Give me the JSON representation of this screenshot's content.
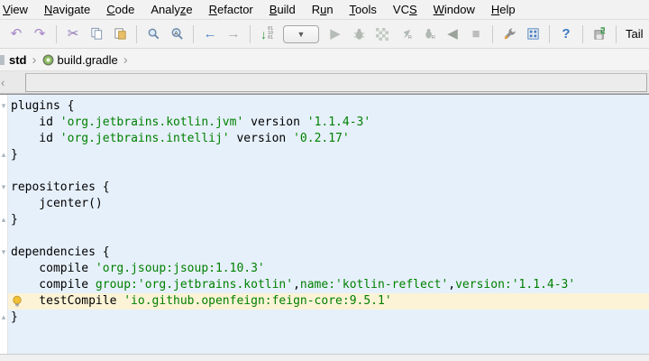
{
  "menu": {
    "items": [
      {
        "label": "View",
        "u": 0
      },
      {
        "label": "Navigate",
        "u": 0
      },
      {
        "label": "Code",
        "u": 0
      },
      {
        "label": "Analyze",
        "u": 5
      },
      {
        "label": "Refactor",
        "u": 0
      },
      {
        "label": "Build",
        "u": 0
      },
      {
        "label": "Run",
        "u": 1
      },
      {
        "label": "Tools",
        "u": 0
      },
      {
        "label": "VCS",
        "u": 2
      },
      {
        "label": "Window",
        "u": 0
      },
      {
        "label": "Help",
        "u": 0
      }
    ]
  },
  "toolbar": {
    "items": [
      {
        "name": "undo",
        "kind": "glyph",
        "glyph": "↶",
        "color": "#a583c6"
      },
      {
        "name": "redo",
        "kind": "glyph",
        "glyph": "↷",
        "color": "#a583c6"
      },
      {
        "kind": "sep"
      },
      {
        "name": "cut",
        "kind": "glyph",
        "glyph": "✂",
        "color": "#8d76b5"
      },
      {
        "name": "copy",
        "kind": "copy"
      },
      {
        "name": "paste",
        "kind": "paste"
      },
      {
        "kind": "sep"
      },
      {
        "name": "find",
        "kind": "magnifier"
      },
      {
        "name": "replace",
        "kind": "magnifier-a"
      },
      {
        "kind": "sep"
      },
      {
        "name": "back",
        "kind": "glyph",
        "glyph": "←",
        "color": "#4c86c8"
      },
      {
        "name": "forward",
        "kind": "glyph",
        "glyph": "→",
        "color": "#aaaaaa"
      },
      {
        "kind": "sep"
      },
      {
        "name": "update-project",
        "kind": "digits",
        "bits": [
          "01",
          "10",
          "01"
        ]
      },
      {
        "name": "run-configurations",
        "kind": "combo",
        "glyph": "▼"
      },
      {
        "name": "run",
        "kind": "glyph",
        "glyph": "▶",
        "color": "#b6bcb6"
      },
      {
        "name": "debug",
        "kind": "bug"
      },
      {
        "name": "run-with-coverage",
        "kind": "checker"
      },
      {
        "name": "profile",
        "kind": "rocketR"
      },
      {
        "name": "attach-profiler",
        "kind": "bugR"
      },
      {
        "name": "rerun",
        "kind": "glyph",
        "glyph": "◀",
        "color": "#9aa39a"
      },
      {
        "name": "stop",
        "kind": "glyph",
        "glyph": "■",
        "color": "#bcbcbc"
      },
      {
        "kind": "sep"
      },
      {
        "name": "settings",
        "kind": "wrench"
      },
      {
        "name": "project-structure",
        "kind": "grid"
      },
      {
        "kind": "sep"
      },
      {
        "name": "help",
        "kind": "glyph",
        "glyph": "?",
        "color": "#3b78c2",
        "bold": true
      },
      {
        "kind": "sep"
      },
      {
        "name": "save-tail",
        "kind": "disk"
      },
      {
        "kind": "sep"
      },
      {
        "name": "tail",
        "kind": "label",
        "label": "Tail"
      }
    ]
  },
  "breadcrumbs": {
    "items": [
      "std",
      "build.gradle"
    ]
  },
  "editor": {
    "file_language": "gradle",
    "lines": [
      {
        "fold": "start",
        "segments": [
          {
            "t": "plugins {",
            "c": "p"
          }
        ]
      },
      {
        "segments": [
          {
            "t": "    id ",
            "c": "p"
          },
          {
            "t": "'org.jetbrains.kotlin.jvm'",
            "c": "s"
          },
          {
            "t": " version ",
            "c": "p"
          },
          {
            "t": "'1.1.4-3'",
            "c": "s"
          }
        ]
      },
      {
        "segments": [
          {
            "t": "    id ",
            "c": "p"
          },
          {
            "t": "'org.jetbrains.intellij'",
            "c": "s"
          },
          {
            "t": " version ",
            "c": "p"
          },
          {
            "t": "'0.2.17'",
            "c": "s"
          }
        ]
      },
      {
        "fold": "end",
        "segments": [
          {
            "t": "}",
            "c": "p"
          }
        ]
      },
      {
        "segments": []
      },
      {
        "fold": "start",
        "segments": [
          {
            "t": "repositories {",
            "c": "p"
          }
        ]
      },
      {
        "segments": [
          {
            "t": "    jcenter()",
            "c": "p"
          }
        ]
      },
      {
        "fold": "end",
        "segments": [
          {
            "t": "}",
            "c": "p"
          }
        ]
      },
      {
        "segments": []
      },
      {
        "fold": "start",
        "segments": [
          {
            "t": "dependencies {",
            "c": "p"
          }
        ]
      },
      {
        "segments": [
          {
            "t": "    compile ",
            "c": "p"
          },
          {
            "t": "'org.jsoup:jsoup:1.10.3'",
            "c": "s"
          }
        ]
      },
      {
        "segments": [
          {
            "t": "    compile ",
            "c": "p"
          },
          {
            "t": "group:",
            "c": "m"
          },
          {
            "t": "'org.jetbrains.kotlin'",
            "c": "s"
          },
          {
            "t": ",",
            "c": "p"
          },
          {
            "t": "name:",
            "c": "m"
          },
          {
            "t": "'kotlin-reflect'",
            "c": "s"
          },
          {
            "t": ",",
            "c": "p"
          },
          {
            "t": "version:",
            "c": "m"
          },
          {
            "t": "'1.1.4-3'",
            "c": "s"
          }
        ]
      },
      {
        "highlight": true,
        "bulb": true,
        "segments": [
          {
            "t": "    testCompile ",
            "c": "p"
          },
          {
            "t": "'io.github.openfeign:feign-core:9.5.1'",
            "c": "s"
          }
        ]
      },
      {
        "fold": "end",
        "segments": [
          {
            "t": "}",
            "c": "p"
          }
        ]
      }
    ]
  },
  "colors": {
    "editor_background": "#e6f0fb",
    "caret_line_background": "#fcf3d6",
    "string_green": "#008000",
    "chrome_gray": "#f2f2f2",
    "bulb_yellow": "#f2c036"
  }
}
